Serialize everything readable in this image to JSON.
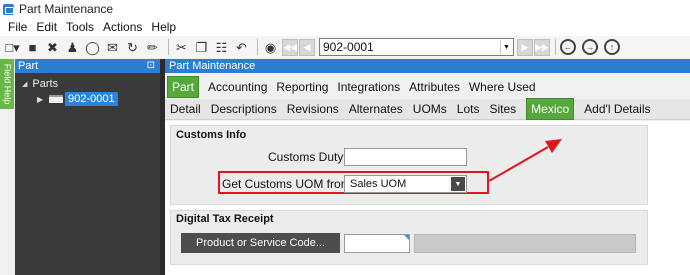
{
  "window": {
    "title": "Part Maintenance"
  },
  "menu": [
    "File",
    "Edit",
    "Tools",
    "Actions",
    "Help"
  ],
  "toolbar": {
    "part_selector_value": "902-0001",
    "icons": [
      "new-icon",
      "save-icon",
      "delete-icon",
      "people-icon",
      "clear-icon",
      "attachment-icon",
      "refresh-icon",
      "broom-icon",
      "cut-icon",
      "copy-icon",
      "paste-icon",
      "undo-icon",
      "binoculars-icon",
      "first-record-icon",
      "previous-record-icon",
      "next-record-icon",
      "last-record-icon",
      "back-icon",
      "forward-icon",
      "up-icon"
    ]
  },
  "field_help": {
    "label": "Field Help"
  },
  "tree": {
    "header": "Part",
    "root_label": "Parts",
    "selected_part": "902-0001"
  },
  "main": {
    "header": "Part Maintenance",
    "primary_tabs": [
      "Part",
      "Accounting",
      "Reporting",
      "Integrations",
      "Attributes",
      "Where Used"
    ],
    "secondary_tabs": [
      "Detail",
      "Descriptions",
      "Revisions",
      "Alternates",
      "UOMs",
      "Lots",
      "Sites",
      "Mexico",
      "Add'l Details"
    ],
    "active_primary_tab": "Part",
    "active_secondary_tab": "Mexico"
  },
  "customs_info": {
    "title": "Customs Info",
    "customs_duty_label": "Customs Duty:",
    "customs_duty_value": "",
    "uom_label": "Get Customs UOM from:",
    "uom_value": "Sales UOM"
  },
  "digital_tax_receipt": {
    "title": "Digital Tax Receipt",
    "product_code_button": "Product or Service Code...",
    "product_code_value": "",
    "product_description_value": ""
  },
  "colors": {
    "accent_blue": "#2c7ed1",
    "active_tab_green": "#56a83c",
    "annotation_red": "#e0161c",
    "tree_background": "#3a3a3a"
  }
}
